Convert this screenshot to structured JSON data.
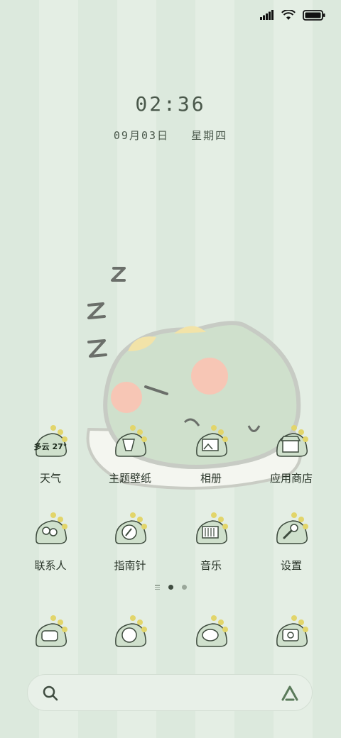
{
  "clock": {
    "time": "02:36"
  },
  "date": {
    "day": "09月03日",
    "weekday": "星期四"
  },
  "apps_row1": [
    {
      "label": "天气",
      "icon": "weather-icon",
      "badge": "多云 27°"
    },
    {
      "label": "主题壁纸",
      "icon": "theme-icon"
    },
    {
      "label": "相册",
      "icon": "gallery-icon"
    },
    {
      "label": "应用商店",
      "icon": "store-icon"
    }
  ],
  "apps_row2": [
    {
      "label": "联系人",
      "icon": "contacts-icon"
    },
    {
      "label": "指南针",
      "icon": "compass-icon"
    },
    {
      "label": "音乐",
      "icon": "music-icon"
    },
    {
      "label": "设置",
      "icon": "settings-icon"
    }
  ],
  "dock": [
    {
      "icon": "phone-icon"
    },
    {
      "icon": "browser-icon"
    },
    {
      "icon": "messages-icon"
    },
    {
      "icon": "camera-icon"
    }
  ],
  "pages": {
    "count": 2,
    "active": 1
  },
  "colors": {
    "accent": "#4f6b4f",
    "dino": "#cfe0cc",
    "spike": "#e2d56a"
  }
}
